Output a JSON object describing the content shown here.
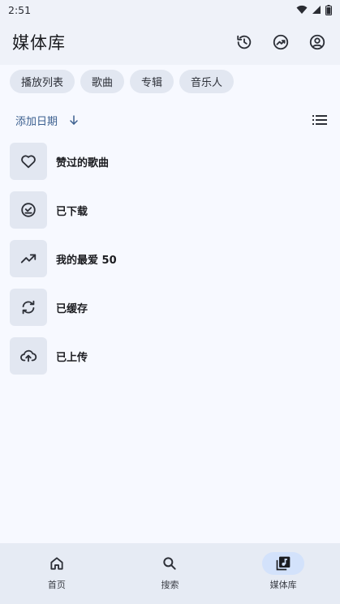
{
  "status": {
    "time": "2:51"
  },
  "appbar": {
    "title": "媒体库"
  },
  "chips": [
    "播放列表",
    "歌曲",
    "专辑",
    "音乐人"
  ],
  "sort": {
    "label": "添加日期"
  },
  "items": [
    {
      "label": "赞过的歌曲",
      "icon": "heart-icon"
    },
    {
      "label": "已下载",
      "icon": "download-check-icon"
    },
    {
      "label": "我的最爱 50",
      "icon": "trending-up-icon"
    },
    {
      "label": "已缓存",
      "icon": "cached-icon"
    },
    {
      "label": "已上传",
      "icon": "cloud-upload-icon"
    }
  ],
  "nav": [
    {
      "label": "首页",
      "icon": "home-icon"
    },
    {
      "label": "搜索",
      "icon": "search-icon"
    },
    {
      "label": "媒体库",
      "icon": "library-music-icon",
      "active": true
    }
  ],
  "colors": {
    "background": "#f7f9ff",
    "topbar": "#eff2f9",
    "chip": "#e2e7f1",
    "accent": "#3b5f8f",
    "active_pill": "#d3e2fb"
  }
}
